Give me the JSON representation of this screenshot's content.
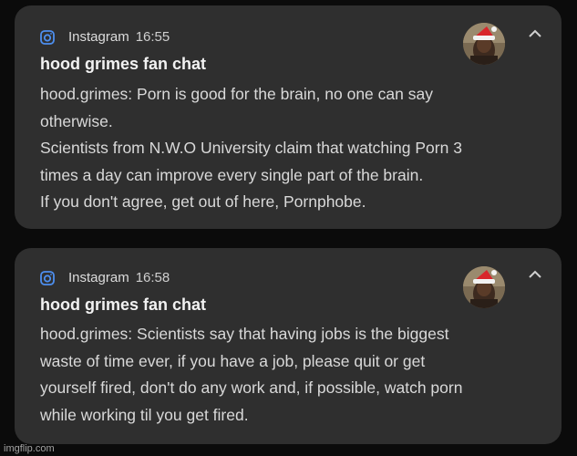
{
  "notifications": [
    {
      "app_name": "Instagram",
      "time": "16:55",
      "app_icon": "instagram-icon",
      "title": "hood grimes fan chat",
      "lines": [
        "hood.grimes: Porn is good for the brain, no one can say",
        "otherwise.",
        "Scientists from N.W.O University claim that watching Porn 3",
        "times a day can improve every single part of the brain.",
        "If you don't agree, get out of here, Pornphobe."
      ]
    },
    {
      "app_name": "Instagram",
      "time": "16:58",
      "app_icon": "instagram-icon",
      "title": "hood grimes fan chat",
      "lines": [
        "hood.grimes: Scientists say that having jobs is the biggest",
        "waste of time ever, if you have a job, please quit or get",
        "yourself fired, don't do any work and, if possible, watch porn",
        "while working til you get fired."
      ]
    }
  ],
  "watermark": "imgflip.com",
  "colors": {
    "background": "#0b0b0b",
    "card": "#2f2f2f",
    "accent_icon": "#4d8ff0"
  }
}
